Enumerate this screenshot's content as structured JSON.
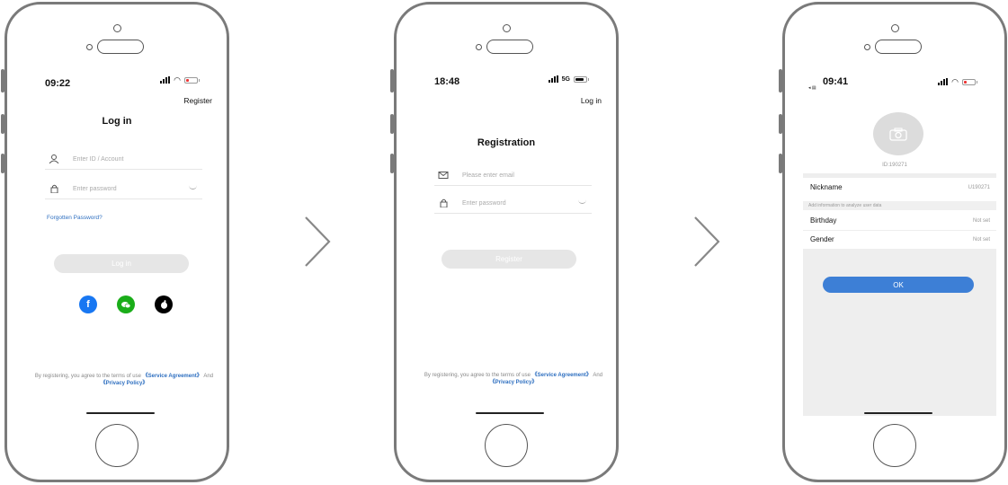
{
  "colors": {
    "accent": "#3d7fd6",
    "link": "#2e6fc0",
    "button_disabled": "#e6e6e6",
    "battery_low": "#e33333"
  },
  "arrows": {
    "icon": "chevron-right-icon"
  },
  "login": {
    "time": "09:22",
    "top_link": "Register",
    "title": "Log in",
    "account_placeholder": "Enter ID / Account",
    "password_placeholder": "Enter password",
    "forgot_link": "Forgotten Password?",
    "submit_label": "Log in",
    "socials": [
      {
        "name": "facebook-icon",
        "glyph": "f",
        "color": "#1877f2"
      },
      {
        "name": "wechat-icon",
        "glyph": "●",
        "color": "#1aad19"
      },
      {
        "name": "apple-icon",
        "glyph": "●",
        "color": "#000000"
      }
    ],
    "legal": {
      "prefix": "By registering, you agree to the terms of use ",
      "service": "《Service Agreement》",
      "and": " And ",
      "privacy": "《Privacy Policy》"
    }
  },
  "registration": {
    "time": "18:48",
    "network": "5G",
    "top_link": "Log in",
    "title": "Registration",
    "email_placeholder": "Please enter email",
    "password_placeholder": "Enter password",
    "submit_label": "Register",
    "legal": {
      "prefix": "By registering, you agree to the terms of use ",
      "service": "《Service Agreement》",
      "and": " And ",
      "privacy": "《Privacy Policy》"
    }
  },
  "profile": {
    "time": "09:41",
    "back_label": "◂ ▤",
    "user_id": "ID:190271",
    "rows": {
      "nickname": {
        "label": "Nickname",
        "value": "U190271"
      },
      "hint": "Add information to analyze user data",
      "birthday": {
        "label": "Birthday",
        "value": "Not set"
      },
      "gender": {
        "label": "Gender",
        "value": "Not set"
      }
    },
    "ok_label": "OK"
  }
}
